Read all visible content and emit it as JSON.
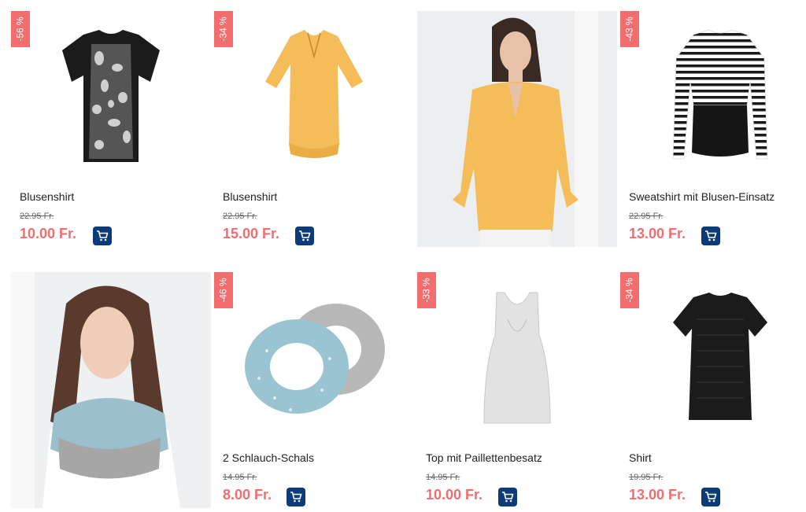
{
  "products": [
    {
      "badge": "-56 %",
      "name": "Blusenshirt",
      "old_price": "22.95 Fr.",
      "new_price": "10.00 Fr.",
      "icon": "blouse-print-icon"
    },
    {
      "badge": "-34 %",
      "name": "Blusenshirt",
      "old_price": "22.95 Fr.",
      "new_price": "15.00 Fr.",
      "icon": "blouse-yellow-icon"
    },
    {
      "badge": "-43 %",
      "name": "Sweatshirt mit Blusen-Einsatz",
      "old_price": "22.95 Fr.",
      "new_price": "13.00 Fr.",
      "icon": "striped-sweatshirt-icon"
    },
    {
      "badge": "-46 %",
      "name": "2 Schlauch-Schals",
      "old_price": "14.95 Fr.",
      "new_price": "8.00 Fr.",
      "icon": "scarves-icon"
    },
    {
      "badge": "-33 %",
      "name": "Top mit Paillettenbesatz",
      "old_price": "14.95 Fr.",
      "new_price": "10.00 Fr.",
      "icon": "tank-top-icon"
    },
    {
      "badge": "-34 %",
      "name": "Shirt",
      "old_price": "19.95 Fr.",
      "new_price": "13.00 Fr.",
      "icon": "black-shirt-icon"
    }
  ],
  "promo_photos": [
    {
      "subject": "model-yellow-blouse"
    },
    {
      "subject": "model-scarf"
    }
  ],
  "colors": {
    "badge": "#f26d6d",
    "price": "#f26d6d",
    "cart": "#0d3a78"
  }
}
